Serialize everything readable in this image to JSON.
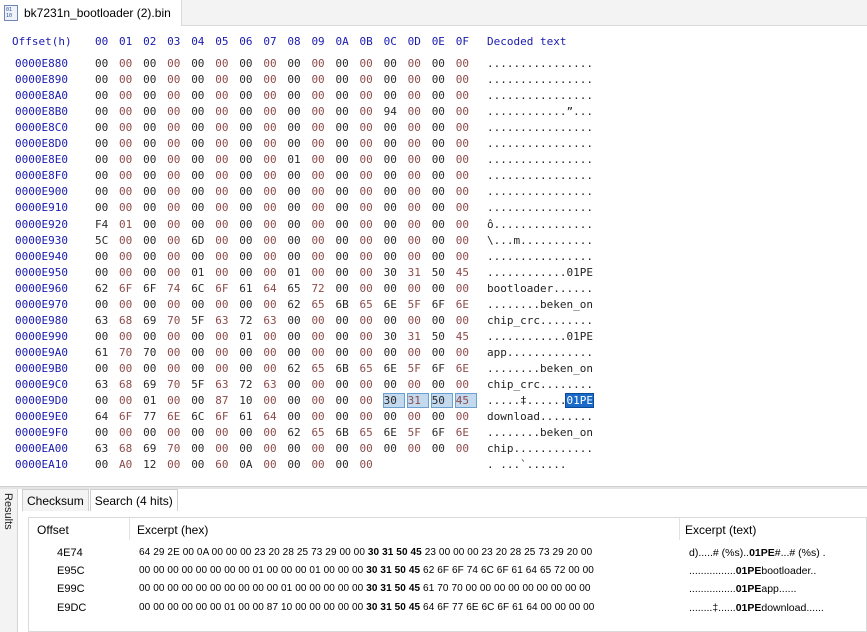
{
  "tab": {
    "title": "bk7231n_bootloader (2).bin",
    "icon": "binary-file-icon"
  },
  "hex": {
    "offset_header": "Offset(h)",
    "column_headers": [
      "00",
      "01",
      "02",
      "03",
      "04",
      "05",
      "06",
      "07",
      "08",
      "09",
      "0A",
      "0B",
      "0C",
      "0D",
      "0E",
      "0F"
    ],
    "decoded_header": "Decoded text",
    "rows": [
      {
        "offset": "0000E880",
        "bytes": [
          "00",
          "00",
          "00",
          "00",
          "00",
          "00",
          "00",
          "00",
          "00",
          "00",
          "00",
          "00",
          "00",
          "00",
          "00",
          "00"
        ],
        "text": "................"
      },
      {
        "offset": "0000E890",
        "bytes": [
          "00",
          "00",
          "00",
          "00",
          "00",
          "00",
          "00",
          "00",
          "00",
          "00",
          "00",
          "00",
          "00",
          "00",
          "00",
          "00"
        ],
        "text": "................"
      },
      {
        "offset": "0000E8A0",
        "bytes": [
          "00",
          "00",
          "00",
          "00",
          "00",
          "00",
          "00",
          "00",
          "00",
          "00",
          "00",
          "00",
          "00",
          "00",
          "00",
          "00"
        ],
        "text": "................"
      },
      {
        "offset": "0000E8B0",
        "bytes": [
          "00",
          "00",
          "00",
          "00",
          "00",
          "00",
          "00",
          "00",
          "00",
          "00",
          "00",
          "00",
          "94",
          "00",
          "00",
          "00"
        ],
        "text": "............”..."
      },
      {
        "offset": "0000E8C0",
        "bytes": [
          "00",
          "00",
          "00",
          "00",
          "00",
          "00",
          "00",
          "00",
          "00",
          "00",
          "00",
          "00",
          "00",
          "00",
          "00",
          "00"
        ],
        "text": "................"
      },
      {
        "offset": "0000E8D0",
        "bytes": [
          "00",
          "00",
          "00",
          "00",
          "00",
          "00",
          "00",
          "00",
          "00",
          "00",
          "00",
          "00",
          "00",
          "00",
          "00",
          "00"
        ],
        "text": "................"
      },
      {
        "offset": "0000E8E0",
        "bytes": [
          "00",
          "00",
          "00",
          "00",
          "00",
          "00",
          "00",
          "00",
          "01",
          "00",
          "00",
          "00",
          "00",
          "00",
          "00",
          "00"
        ],
        "text": "................"
      },
      {
        "offset": "0000E8F0",
        "bytes": [
          "00",
          "00",
          "00",
          "00",
          "00",
          "00",
          "00",
          "00",
          "00",
          "00",
          "00",
          "00",
          "00",
          "00",
          "00",
          "00"
        ],
        "text": "................"
      },
      {
        "offset": "0000E900",
        "bytes": [
          "00",
          "00",
          "00",
          "00",
          "00",
          "00",
          "00",
          "00",
          "00",
          "00",
          "00",
          "00",
          "00",
          "00",
          "00",
          "00"
        ],
        "text": "................"
      },
      {
        "offset": "0000E910",
        "bytes": [
          "00",
          "00",
          "00",
          "00",
          "00",
          "00",
          "00",
          "00",
          "00",
          "00",
          "00",
          "00",
          "00",
          "00",
          "00",
          "00"
        ],
        "text": "................"
      },
      {
        "offset": "0000E920",
        "bytes": [
          "F4",
          "01",
          "00",
          "00",
          "00",
          "00",
          "00",
          "00",
          "00",
          "00",
          "00",
          "00",
          "00",
          "00",
          "00",
          "00"
        ],
        "text": "ô..............."
      },
      {
        "offset": "0000E930",
        "bytes": [
          "5C",
          "00",
          "00",
          "00",
          "6D",
          "00",
          "00",
          "00",
          "00",
          "00",
          "00",
          "00",
          "00",
          "00",
          "00",
          "00"
        ],
        "text": "\\...m..........."
      },
      {
        "offset": "0000E940",
        "bytes": [
          "00",
          "00",
          "00",
          "00",
          "00",
          "00",
          "00",
          "00",
          "00",
          "00",
          "00",
          "00",
          "00",
          "00",
          "00",
          "00"
        ],
        "text": "................"
      },
      {
        "offset": "0000E950",
        "bytes": [
          "00",
          "00",
          "00",
          "00",
          "01",
          "00",
          "00",
          "00",
          "01",
          "00",
          "00",
          "00",
          "30",
          "31",
          "50",
          "45"
        ],
        "text": "............01PE"
      },
      {
        "offset": "0000E960",
        "bytes": [
          "62",
          "6F",
          "6F",
          "74",
          "6C",
          "6F",
          "61",
          "64",
          "65",
          "72",
          "00",
          "00",
          "00",
          "00",
          "00",
          "00"
        ],
        "text": "bootloader......"
      },
      {
        "offset": "0000E970",
        "bytes": [
          "00",
          "00",
          "00",
          "00",
          "00",
          "00",
          "00",
          "00",
          "62",
          "65",
          "6B",
          "65",
          "6E",
          "5F",
          "6F",
          "6E"
        ],
        "text": "........beken_on"
      },
      {
        "offset": "0000E980",
        "bytes": [
          "63",
          "68",
          "69",
          "70",
          "5F",
          "63",
          "72",
          "63",
          "00",
          "00",
          "00",
          "00",
          "00",
          "00",
          "00",
          "00"
        ],
        "text": "chip_crc........"
      },
      {
        "offset": "0000E990",
        "bytes": [
          "00",
          "00",
          "00",
          "00",
          "00",
          "00",
          "01",
          "00",
          "00",
          "00",
          "00",
          "00",
          "30",
          "31",
          "50",
          "45"
        ],
        "text": "............01PE"
      },
      {
        "offset": "0000E9A0",
        "bytes": [
          "61",
          "70",
          "70",
          "00",
          "00",
          "00",
          "00",
          "00",
          "00",
          "00",
          "00",
          "00",
          "00",
          "00",
          "00",
          "00"
        ],
        "text": "app............."
      },
      {
        "offset": "0000E9B0",
        "bytes": [
          "00",
          "00",
          "00",
          "00",
          "00",
          "00",
          "00",
          "00",
          "62",
          "65",
          "6B",
          "65",
          "6E",
          "5F",
          "6F",
          "6E"
        ],
        "text": "........beken_on"
      },
      {
        "offset": "0000E9C0",
        "bytes": [
          "63",
          "68",
          "69",
          "70",
          "5F",
          "63",
          "72",
          "63",
          "00",
          "00",
          "00",
          "00",
          "00",
          "00",
          "00",
          "00"
        ],
        "text": "chip_crc........"
      },
      {
        "offset": "0000E9D0",
        "bytes": [
          "00",
          "00",
          "01",
          "00",
          "00",
          "87",
          "10",
          "00",
          "00",
          "00",
          "00",
          "00",
          "30",
          "31",
          "50",
          "45"
        ],
        "text": ".....‡......01PE",
        "selected_from": 12
      },
      {
        "offset": "0000E9E0",
        "bytes": [
          "64",
          "6F",
          "77",
          "6E",
          "6C",
          "6F",
          "61",
          "64",
          "00",
          "00",
          "00",
          "00",
          "00",
          "00",
          "00",
          "00"
        ],
        "text": "download........"
      },
      {
        "offset": "0000E9F0",
        "bytes": [
          "00",
          "00",
          "00",
          "00",
          "00",
          "00",
          "00",
          "00",
          "62",
          "65",
          "6B",
          "65",
          "6E",
          "5F",
          "6F",
          "6E"
        ],
        "text": "........beken_on"
      },
      {
        "offset": "0000EA00",
        "bytes": [
          "63",
          "68",
          "69",
          "70",
          "00",
          "00",
          "00",
          "00",
          "00",
          "00",
          "00",
          "00",
          "00",
          "00",
          "00",
          "00"
        ],
        "text": "chip............"
      },
      {
        "offset": "0000EA10",
        "bytes": [
          "00",
          "A0",
          "12",
          "00",
          "00",
          "60",
          "0A",
          "00",
          "00",
          "00",
          "00",
          "00"
        ],
        "text": ". ...`......"
      }
    ]
  },
  "results": {
    "side_label": "Results",
    "tabs": [
      {
        "label": "Checksum",
        "active": false
      },
      {
        "label": "Search (4 hits)",
        "active": true
      }
    ],
    "columns": {
      "offset": "Offset",
      "hex": "Excerpt (hex)",
      "text": "Excerpt (text)"
    },
    "rows": [
      {
        "offset": "4E74",
        "hex_before": "64 29 2E 00 0A 00 00 00 23 20 28 25 73 29 00 00 ",
        "hex_match": "30 31 50 45",
        "hex_after": " 23 00 00 00 23 20 28 25 73 29 20 00",
        "text_before": "d).....# (%s)..",
        "text_match": "01PE",
        "text_after": "#...# (%s) ."
      },
      {
        "offset": "E95C",
        "hex_before": "00 00 00 00 00 00 00 00 01 00 00 00 01 00 00 00 ",
        "hex_match": "30 31 50 45",
        "hex_after": " 62 6F 6F 74 6C 6F 61 64 65 72 00 00",
        "text_before": "................",
        "text_match": "01PE",
        "text_after": "bootloader.."
      },
      {
        "offset": "E99C",
        "hex_before": "00 00 00 00 00 00 00 00 00 00 01 00 00 00 00 00 ",
        "hex_match": "30 31 50 45",
        "hex_after": " 61 70 70 00 00 00 00 00 00 00 00 00",
        "text_before": "................",
        "text_match": "01PE",
        "text_after": "app......"
      },
      {
        "offset": "E9DC",
        "hex_before": "00 00 00 00 00 00 01 00 00 87 10 00 00 00 00 00 ",
        "hex_match": "30 31 50 45",
        "hex_after": " 64 6F 77 6E 6C 6F 61 64 00 00 00 00",
        "text_before": "........‡......",
        "text_match": "01PE",
        "text_after": "download......"
      }
    ]
  }
}
